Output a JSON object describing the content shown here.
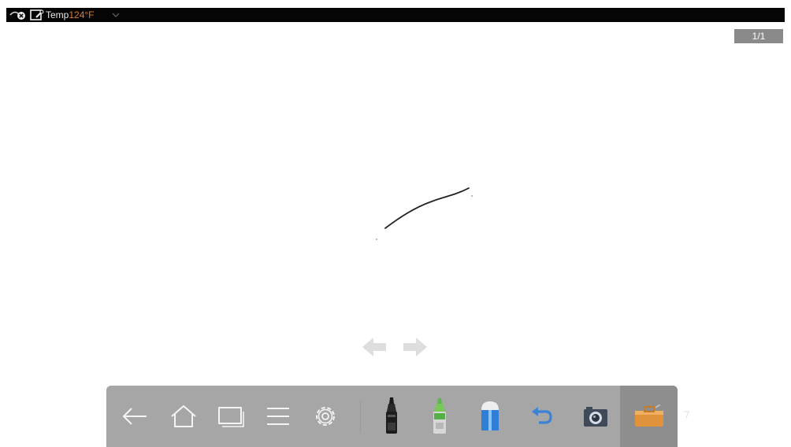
{
  "status_bar": {
    "temp_label": "Temp",
    "temp_value": "124°F",
    "temp_value_color": "#e07a2a",
    "icons": [
      "eye-close-icon",
      "screen-pen-icon",
      "chevron-down-icon"
    ]
  },
  "page_indicator": {
    "text": "1/1"
  },
  "page_nav": {
    "prev_icon": "arrow-left-icon",
    "next_icon": "arrow-right-icon"
  },
  "toolbar": {
    "background": "#a6a6a6",
    "buttons": [
      {
        "name": "back",
        "icon": "arrow-left-icon"
      },
      {
        "name": "home",
        "icon": "home-icon"
      },
      {
        "name": "windows",
        "icon": "window-icon"
      },
      {
        "name": "menu",
        "icon": "menu-icon"
      },
      {
        "name": "settings",
        "icon": "gear-icon"
      },
      {
        "name": "marker",
        "icon": "black-marker-icon"
      },
      {
        "name": "highlighter",
        "icon": "green-highlighter-icon"
      },
      {
        "name": "eraser",
        "icon": "eraser-icon"
      },
      {
        "name": "undo",
        "icon": "undo-icon"
      },
      {
        "name": "screenshot",
        "icon": "camera-icon"
      },
      {
        "name": "toolbox",
        "icon": "toolbox-icon",
        "active": true
      }
    ]
  }
}
